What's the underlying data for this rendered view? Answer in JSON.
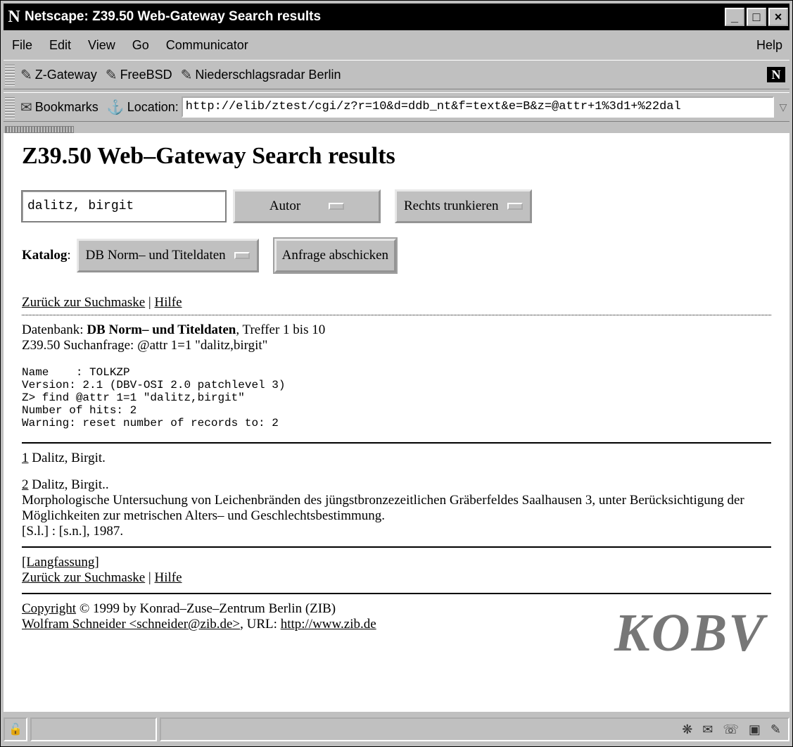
{
  "window": {
    "logo": "N",
    "title": "Netscape: Z39.50 Web-Gateway Search results",
    "buttons": [
      "_",
      "□",
      "×"
    ]
  },
  "menu": {
    "items": [
      "File",
      "Edit",
      "View",
      "Go",
      "Communicator"
    ],
    "help": "Help"
  },
  "personal_toolbar": {
    "items": [
      "Z-Gateway",
      "FreeBSD",
      "Niederschlagsradar Berlin"
    ],
    "logo": "N"
  },
  "location_bar": {
    "bookmarks_label": "Bookmarks",
    "location_label": "Location:",
    "url": "http://elib/ztest/cgi/z?r=10&d=ddb_nt&f=text&e=B&z=@attr+1%3d1+%22dal"
  },
  "page": {
    "heading": "Z39.50 Web–Gateway Search results",
    "form": {
      "query": "dalitz, birgit",
      "field_select": "Autor",
      "truncation_select": "Rechts trunkieren",
      "catalog_label": "Katalog",
      "catalog_select": "DB Norm– und Titeldaten",
      "submit": "Anfrage abschicken"
    },
    "links_top": {
      "back": "Zurück zur Suchmaske",
      "sep": "|",
      "help": "Hilfe"
    },
    "info": {
      "db_prefix": "Datenbank: ",
      "db_name": "DB Norm– und Titeldaten",
      "db_suffix": ", Treffer 1 bis 10",
      "query_line": "Z39.50 Suchanfrage: @attr 1=1 \"dalitz,birgit\""
    },
    "log": "Name    : TOLKZP\nVersion: 2.1 (DBV-OSI 2.0 patchlevel 3)\nZ> find @attr 1=1 \"dalitz,birgit\"\nNumber of hits: 2\nWarning: reset number of records to: 2",
    "records": [
      {
        "num": "1",
        "text": " Dalitz, Birgit."
      },
      {
        "num": "2",
        "text": " Dalitz, Birgit..",
        "title": "Morphologische Untersuchung von Leichenbränden des jüngstbronzezeitlichen Gräberfeldes Saalhausen 3, unter Berücksichtigung der Möglichkeiten zur metrischen Alters– und Geschlechtsbestimmung.",
        "imprint": "[S.l.] : [s.n.], 1987."
      }
    ],
    "langfassung": "[Langfassung]",
    "links_bottom": {
      "back": "Zurück zur Suchmaske",
      "sep": "|",
      "help": "Hilfe"
    },
    "footer": {
      "copyright_link": "Copyright",
      "copyright_text": " © 1999 by Konrad–Zuse–Zentrum Berlin (ZIB)",
      "author_link": "Wolfram Schneider <schneider@zib.de>",
      "url_prefix": ", URL: ",
      "url_link": "http://www.zib.de",
      "logo": "KOBV"
    }
  },
  "status_icons": [
    "network-icon",
    "mail-icon",
    "discussion-icon",
    "composer-icon",
    "edit-icon"
  ]
}
